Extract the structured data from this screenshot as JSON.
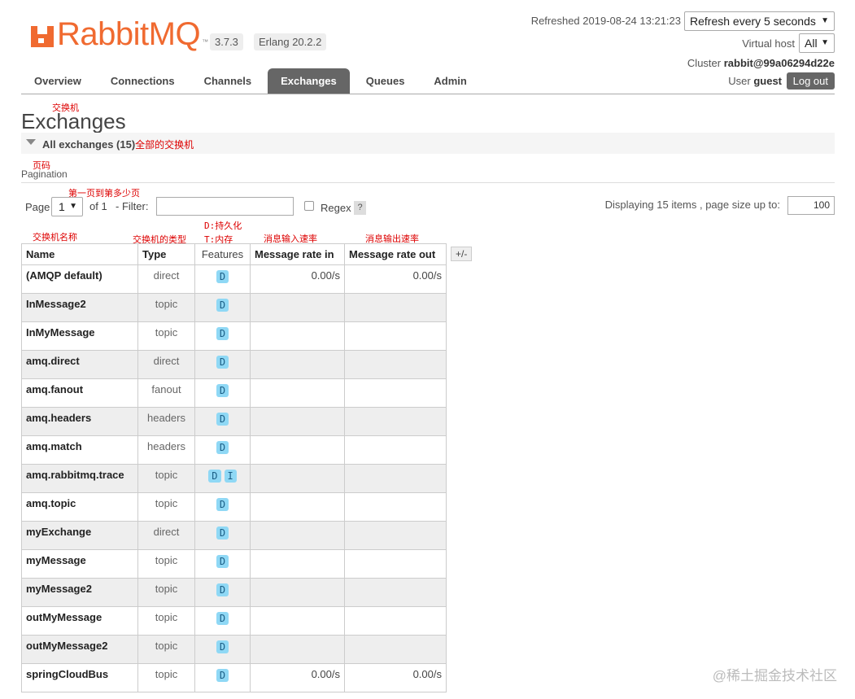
{
  "brand": {
    "name": "RabbitMQ",
    "tm": "™",
    "version": "3.7.3",
    "erlang": "Erlang 20.2.2"
  },
  "header": {
    "refreshed": "Refreshed 2019-08-24 13:21:23",
    "refresh_select": "Refresh every 5 seconds",
    "vhost_label": "Virtual host",
    "vhost_select": "All",
    "cluster_label": "Cluster",
    "cluster_name": "rabbit@99a06294d22e",
    "user_label": "User",
    "user_name": "guest",
    "logout": "Log out"
  },
  "tabs": [
    "Overview",
    "Connections",
    "Channels",
    "Exchanges",
    "Queues",
    "Admin"
  ],
  "active_tab": "Exchanges",
  "annotations": {
    "title": "交换机",
    "all": "全部的交换机",
    "pagination": "页码",
    "page": "第一页到第多少页",
    "name": "交换机名称",
    "type": "交换机的类型",
    "features_d": "D:持久化",
    "features_t": "T:内存",
    "rate_in": "消息输入速率",
    "rate_out": "消息输出速率"
  },
  "page_title": "Exchanges",
  "section_label": "All exchanges (15)",
  "pagination": {
    "heading": "Pagination",
    "page_label": "Page",
    "page_value": "1",
    "of_label": "of 1",
    "filter_label": "- Filter:",
    "filter_value": "",
    "regex_label": "Regex",
    "help": "?",
    "displaying": "Displaying 15 items , page size up to:",
    "page_size": "100"
  },
  "table": {
    "headers": [
      "Name",
      "Type",
      "Features",
      "Message rate in",
      "Message rate out"
    ],
    "toggle": "+/-",
    "rows": [
      {
        "name": "(AMQP default)",
        "type": "direct",
        "features": [
          "D"
        ],
        "rate_in": "0.00/s",
        "rate_out": "0.00/s"
      },
      {
        "name": "InMessage2",
        "type": "topic",
        "features": [
          "D"
        ],
        "rate_in": "",
        "rate_out": ""
      },
      {
        "name": "InMyMessage",
        "type": "topic",
        "features": [
          "D"
        ],
        "rate_in": "",
        "rate_out": ""
      },
      {
        "name": "amq.direct",
        "type": "direct",
        "features": [
          "D"
        ],
        "rate_in": "",
        "rate_out": ""
      },
      {
        "name": "amq.fanout",
        "type": "fanout",
        "features": [
          "D"
        ],
        "rate_in": "",
        "rate_out": ""
      },
      {
        "name": "amq.headers",
        "type": "headers",
        "features": [
          "D"
        ],
        "rate_in": "",
        "rate_out": ""
      },
      {
        "name": "amq.match",
        "type": "headers",
        "features": [
          "D"
        ],
        "rate_in": "",
        "rate_out": ""
      },
      {
        "name": "amq.rabbitmq.trace",
        "type": "topic",
        "features": [
          "D",
          "I"
        ],
        "rate_in": "",
        "rate_out": ""
      },
      {
        "name": "amq.topic",
        "type": "topic",
        "features": [
          "D"
        ],
        "rate_in": "",
        "rate_out": ""
      },
      {
        "name": "myExchange",
        "type": "direct",
        "features": [
          "D"
        ],
        "rate_in": "",
        "rate_out": ""
      },
      {
        "name": "myMessage",
        "type": "topic",
        "features": [
          "D"
        ],
        "rate_in": "",
        "rate_out": ""
      },
      {
        "name": "myMessage2",
        "type": "topic",
        "features": [
          "D"
        ],
        "rate_in": "",
        "rate_out": ""
      },
      {
        "name": "outMyMessage",
        "type": "topic",
        "features": [
          "D"
        ],
        "rate_in": "",
        "rate_out": ""
      },
      {
        "name": "outMyMessage2",
        "type": "topic",
        "features": [
          "D"
        ],
        "rate_in": "",
        "rate_out": ""
      },
      {
        "name": "springCloudBus",
        "type": "topic",
        "features": [
          "D"
        ],
        "rate_in": "0.00/s",
        "rate_out": "0.00/s"
      }
    ]
  },
  "watermark": "@稀土掘金技术社区",
  "colors": {
    "brand": "#f06a30",
    "active_tab": "#666666",
    "badge": "#8fd8f5",
    "annotation": "#dd0000"
  }
}
